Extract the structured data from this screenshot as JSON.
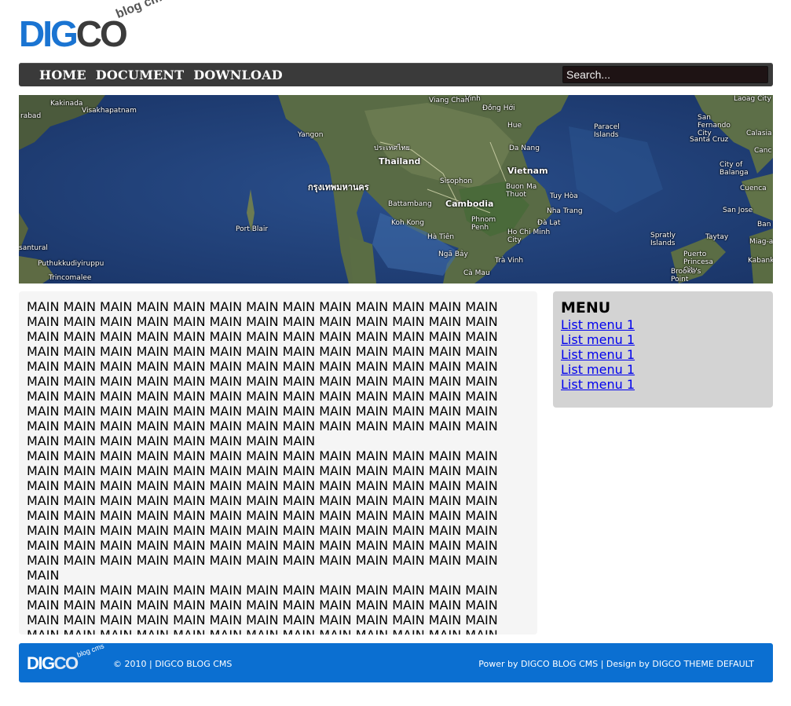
{
  "logo": {
    "part1": "DIG",
    "part2": "CO",
    "tagline": "blog cms"
  },
  "nav": {
    "items": [
      "HOME",
      "DOCUMENT",
      "DOWNLOAD"
    ]
  },
  "search": {
    "value": "Search..."
  },
  "banner": {
    "labels": [
      {
        "text": "Kakinada"
      },
      {
        "text": "rabad"
      },
      {
        "text": "Visakhapatnam"
      },
      {
        "text": "Yangon"
      },
      {
        "text": "ประเทศไทย"
      },
      {
        "text": "Thailand"
      },
      {
        "text": "กรุงเทพมหานคร"
      },
      {
        "text": "Sisophon"
      },
      {
        "text": "Battambang"
      },
      {
        "text": "Cambodia"
      },
      {
        "text": "Phnom Penh"
      },
      {
        "text": "Koh Kong"
      },
      {
        "text": "Hà Tiên"
      },
      {
        "text": "Ho Chi Minh City"
      },
      {
        "text": "Vietnam"
      },
      {
        "text": "Da Nang"
      },
      {
        "text": "Hue"
      },
      {
        "text": "Đồng Hới"
      },
      {
        "text": "Vinh"
      },
      {
        "text": "Viang Chan"
      },
      {
        "text": "Buon Ma Thuot"
      },
      {
        "text": "Tuy Hòa"
      },
      {
        "text": "Nha Trang"
      },
      {
        "text": "Đà Lạt"
      },
      {
        "text": "Ngã Bảy"
      },
      {
        "text": "Trà Vinh"
      },
      {
        "text": "Cà Mau"
      },
      {
        "text": "Paracel Islands"
      },
      {
        "text": "Spratly Islands"
      },
      {
        "text": "Puerto Princesa City"
      },
      {
        "text": "Brooke's Point"
      },
      {
        "text": "Taytay"
      },
      {
        "text": "San Jose"
      },
      {
        "text": "Santa Cruz"
      },
      {
        "text": "City of Balanga"
      },
      {
        "text": "San Fernando City"
      },
      {
        "text": "Cuenca"
      },
      {
        "text": "Calasia"
      },
      {
        "text": "Laoag City"
      },
      {
        "text": "Port Blair"
      },
      {
        "text": "Puthukkudiyiruppu"
      },
      {
        "text": "Trincomalee"
      },
      {
        "text": "santural"
      },
      {
        "text": "Kabank"
      },
      {
        "text": "Miag-a"
      },
      {
        "text": "Ban"
      },
      {
        "text": "Canc"
      }
    ]
  },
  "main": {
    "paragraphs": [
      "MAIN MAIN MAIN MAIN MAIN MAIN MAIN MAIN MAIN MAIN MAIN MAIN MAIN MAIN MAIN MAIN MAIN MAIN MAIN MAIN MAIN MAIN MAIN MAIN MAIN MAIN MAIN MAIN MAIN MAIN MAIN MAIN MAIN MAIN MAIN MAIN MAIN MAIN MAIN MAIN MAIN MAIN MAIN MAIN MAIN MAIN MAIN MAIN MAIN MAIN MAIN MAIN MAIN MAIN MAIN MAIN MAIN MAIN MAIN MAIN MAIN MAIN MAIN MAIN MAIN MAIN MAIN MAIN MAIN MAIN MAIN MAIN MAIN MAIN MAIN MAIN MAIN MAIN MAIN MAIN MAIN MAIN MAIN MAIN MAIN MAIN MAIN MAIN MAIN MAIN MAIN MAIN MAIN MAIN MAIN MAIN MAIN MAIN MAIN MAIN MAIN MAIN MAIN MAIN MAIN MAIN MAIN MAIN MAIN MAIN MAIN MAIN MAIN MAIN MAIN MAIN MAIN MAIN MAIN MAIN MAIN MAIN MAIN MAIN MAIN",
      "MAIN MAIN MAIN MAIN MAIN MAIN MAIN MAIN MAIN MAIN MAIN MAIN MAIN MAIN MAIN MAIN MAIN MAIN MAIN MAIN MAIN MAIN MAIN MAIN MAIN MAIN MAIN MAIN MAIN MAIN MAIN MAIN MAIN MAIN MAIN MAIN MAIN MAIN MAIN MAIN MAIN MAIN MAIN MAIN MAIN MAIN MAIN MAIN MAIN MAIN MAIN MAIN MAIN MAIN MAIN MAIN MAIN MAIN MAIN MAIN MAIN MAIN MAIN MAIN MAIN MAIN MAIN MAIN MAIN MAIN MAIN MAIN MAIN MAIN MAIN MAIN MAIN MAIN MAIN MAIN MAIN MAIN MAIN MAIN MAIN MAIN MAIN MAIN MAIN MAIN MAIN MAIN MAIN MAIN MAIN MAIN MAIN MAIN MAIN MAIN MAIN MAIN MAIN MAIN MAIN",
      "MAIN MAIN MAIN MAIN MAIN MAIN MAIN MAIN MAIN MAIN MAIN MAIN MAIN MAIN MAIN MAIN MAIN MAIN MAIN MAIN MAIN MAIN MAIN MAIN MAIN MAIN MAIN MAIN MAIN MAIN MAIN MAIN MAIN MAIN MAIN MAIN MAIN MAIN MAIN MAIN MAIN MAIN MAIN MAIN MAIN MAIN MAIN MAIN MAIN MAIN MAIN MAIN MAIN MAIN MAIN MAIN MAIN MAIN MAIN MAIN MAIN MAIN MAIN MAIN MAIN MAIN MAIN MAIN MAIN MAIN MAIN MAIN MAIN MAIN MAIN MAIN"
    ]
  },
  "sidebar": {
    "title": "MENU",
    "items": [
      "List menu 1",
      "List menu 1",
      "List menu 1",
      "List menu 1",
      "List menu 1"
    ]
  },
  "footer": {
    "logo_part1": "DIG",
    "logo_part2": "CO",
    "logo_tagline": "blog cms",
    "copyright": "© 2010 | DIGCO BLOG CMS",
    "credit": "Power by DIGCO BLOG CMS | Design by DIGCO THEME DEFAULT"
  }
}
